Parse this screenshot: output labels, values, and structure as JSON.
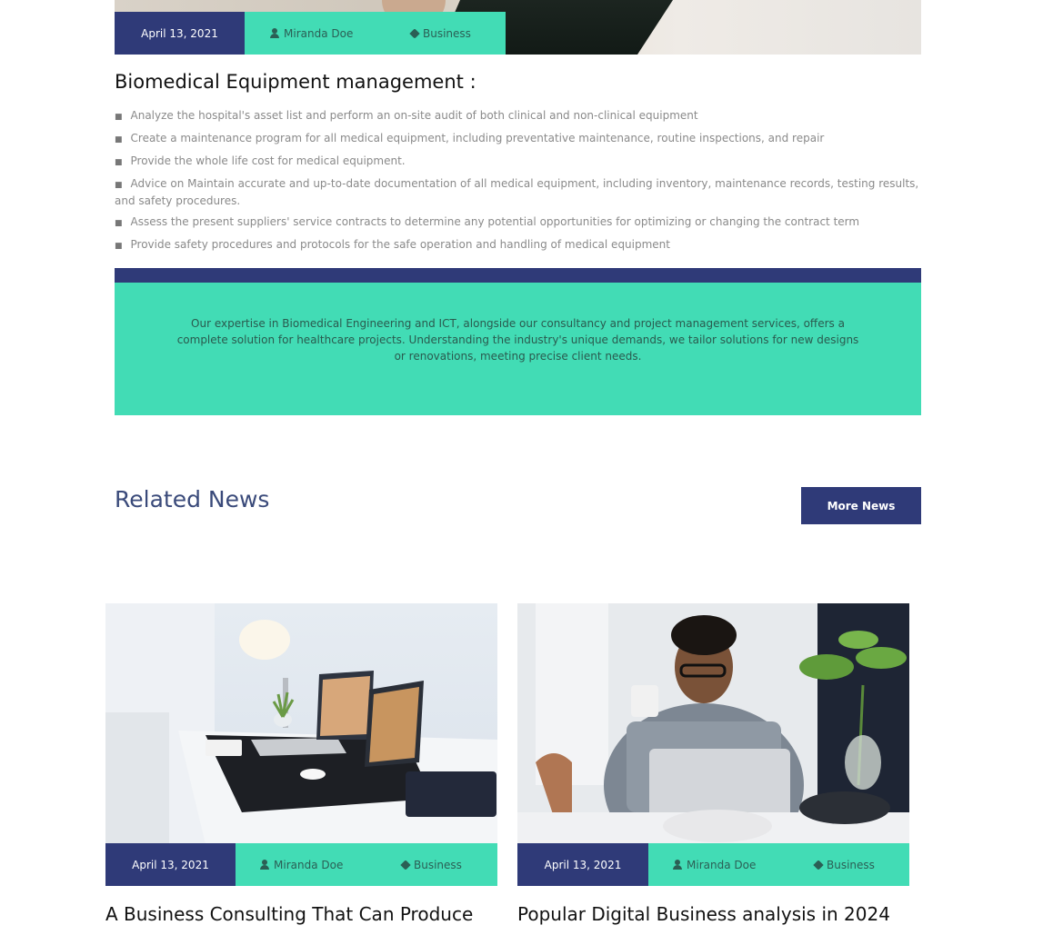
{
  "top_post": {
    "meta": {
      "date": "April 13, 2021",
      "author": "Miranda Doe",
      "category": "Business"
    }
  },
  "article": {
    "heading": "Biomedical Equipment management :",
    "bullets": [
      "Analyze the hospital's asset list and perform an on-site audit of both clinical and non-clinical equipment",
      "Create a maintenance program for all medical equipment, including preventative maintenance, routine inspections, and repair",
      "Provide the whole life cost for medical equipment.",
      "Advice on Maintain accurate and up-to-date documentation of all medical equipment, including inventory, maintenance records, testing results, and safety procedures.",
      "Assess the present suppliers' service contracts to determine any potential opportunities for optimizing or changing the contract term",
      "Provide safety procedures and protocols for the safe operation and handling of medical equipment"
    ],
    "quote": "Our expertise in Biomedical Engineering and ICT, alongside our consultancy and project management services, offers a complete solution for healthcare projects. Understanding the industry's unique demands, we tailor solutions for new designs or renovations, meeting precise client needs."
  },
  "related": {
    "heading": "Related News",
    "more_button": "More News",
    "cards": [
      {
        "date": "April 13, 2021",
        "author": "Miranda Doe",
        "category": "Business",
        "title": "A Business Consulting That Can Produce"
      },
      {
        "date": "April 13, 2021",
        "author": "Miranda Doe",
        "category": "Business",
        "title": "Popular Digital Business analysis in 2024"
      }
    ]
  },
  "colors": {
    "navy": "#2f3a78",
    "mint": "#42dcb5"
  }
}
